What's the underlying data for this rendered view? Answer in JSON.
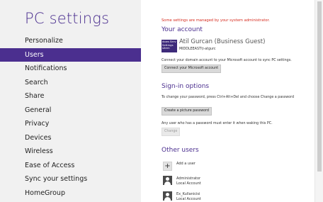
{
  "nav": {
    "title": "PC settings",
    "items": [
      {
        "label": "Personalize"
      },
      {
        "label": "Users"
      },
      {
        "label": "Notifications"
      },
      {
        "label": "Search"
      },
      {
        "label": "Share"
      },
      {
        "label": "General"
      },
      {
        "label": "Privacy"
      },
      {
        "label": "Devices"
      },
      {
        "label": "Wireless"
      },
      {
        "label": "Ease of Access"
      },
      {
        "label": "Sync your settings"
      },
      {
        "label": "HomeGroup"
      }
    ],
    "active_index": 1
  },
  "main": {
    "warning": "Some settings are managed by your system administrator.",
    "account": {
      "title": "Your account",
      "avatar_text": "dows Serv Settings sitem",
      "name": "Atil Gurcan (Business Guest)",
      "domain": "MIDDLEEAST\\t-atgurc",
      "connect_desc": "Connect your domain account to your Microsoft account to sync PC settings.",
      "connect_button": "Connect your Microsoft account"
    },
    "signin": {
      "title": "Sign-in options",
      "desc": "To change your password, press Ctrl+Alt+Del and choose Change a password",
      "picture_button": "Create a picture password",
      "waking_desc": "Any user who has a password must enter it when waking this PC.",
      "change_button": "Change"
    },
    "others": {
      "title": "Other users",
      "add_user": "Add a user",
      "users": [
        {
          "name": "Administrator",
          "type": "Local Account"
        },
        {
          "name": "Ex_Kullanicisi",
          "type": "Local Account"
        }
      ]
    }
  },
  "colors": {
    "accent": "#4b2f8f",
    "warning": "#d62b1e",
    "nav_bg": "#f1f1f1"
  }
}
